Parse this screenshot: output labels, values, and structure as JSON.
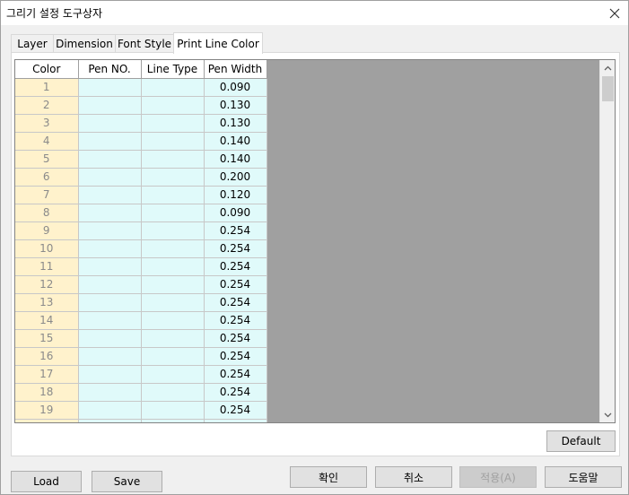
{
  "window": {
    "title": "그리기 설정 도구상자"
  },
  "tabs": [
    {
      "label": "Layer",
      "active": false
    },
    {
      "label": "Dimension",
      "active": false
    },
    {
      "label": "Font Style",
      "active": false
    },
    {
      "label": "Print Line Color",
      "active": true
    }
  ],
  "table": {
    "headers": [
      "Color",
      "Pen NO.",
      "Line Type",
      "Pen Width"
    ],
    "rows": [
      {
        "color": "1",
        "pen_no": "",
        "line_type": "",
        "pen_width": "0.090"
      },
      {
        "color": "2",
        "pen_no": "",
        "line_type": "",
        "pen_width": "0.130"
      },
      {
        "color": "3",
        "pen_no": "",
        "line_type": "",
        "pen_width": "0.130"
      },
      {
        "color": "4",
        "pen_no": "",
        "line_type": "",
        "pen_width": "0.140"
      },
      {
        "color": "5",
        "pen_no": "",
        "line_type": "",
        "pen_width": "0.140"
      },
      {
        "color": "6",
        "pen_no": "",
        "line_type": "",
        "pen_width": "0.200"
      },
      {
        "color": "7",
        "pen_no": "",
        "line_type": "",
        "pen_width": "0.120"
      },
      {
        "color": "8",
        "pen_no": "",
        "line_type": "",
        "pen_width": "0.090"
      },
      {
        "color": "9",
        "pen_no": "",
        "line_type": "",
        "pen_width": "0.254"
      },
      {
        "color": "10",
        "pen_no": "",
        "line_type": "",
        "pen_width": "0.254"
      },
      {
        "color": "11",
        "pen_no": "",
        "line_type": "",
        "pen_width": "0.254"
      },
      {
        "color": "12",
        "pen_no": "",
        "line_type": "",
        "pen_width": "0.254"
      },
      {
        "color": "13",
        "pen_no": "",
        "line_type": "",
        "pen_width": "0.254"
      },
      {
        "color": "14",
        "pen_no": "",
        "line_type": "",
        "pen_width": "0.254"
      },
      {
        "color": "15",
        "pen_no": "",
        "line_type": "",
        "pen_width": "0.254"
      },
      {
        "color": "16",
        "pen_no": "",
        "line_type": "",
        "pen_width": "0.254"
      },
      {
        "color": "17",
        "pen_no": "",
        "line_type": "",
        "pen_width": "0.254"
      },
      {
        "color": "18",
        "pen_no": "",
        "line_type": "",
        "pen_width": "0.254"
      },
      {
        "color": "19",
        "pen_no": "",
        "line_type": "",
        "pen_width": "0.254"
      },
      {
        "color": "",
        "pen_no": "",
        "line_type": "",
        "pen_width": ""
      }
    ]
  },
  "buttons": {
    "default": "Default",
    "load": "Load",
    "save": "Save",
    "ok": "확인",
    "cancel": "취소",
    "apply": "적용(A)",
    "help": "도움말"
  },
  "icons": {
    "close": "close-icon",
    "scroll_up": "chevron-up-icon",
    "scroll_down": "chevron-down-icon"
  },
  "colors": {
    "color_column": "#fff2cc",
    "value_columns": "#e0fafa",
    "grid_background": "#a0a0a0"
  }
}
